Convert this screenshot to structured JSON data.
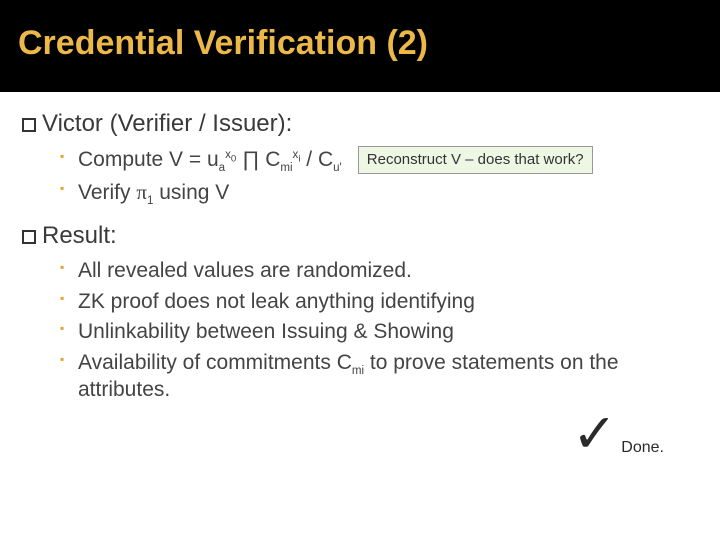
{
  "title": "Credential Verification (2)",
  "section1": {
    "head": "Victor (Verifier / Issuer):",
    "compute_prefix": "Compute V  = u",
    "compute_sub_a": "a",
    "compute_sup_x0": "x",
    "compute_sup_x0_sub": "0",
    "compute_prod": " ∏ C",
    "compute_cm_sub": "mi",
    "compute_sup_xi": "x",
    "compute_sup_xi_sub": "i",
    "compute_div": " / C",
    "compute_cu_sub": "u'",
    "note": "Reconstruct V – does that work?",
    "verify_prefix": "Verify ",
    "verify_pi": "π",
    "verify_sub1": "1",
    "verify_suffix": " using V"
  },
  "section2": {
    "head": "Result:",
    "items": [
      "All revealed values are randomized.",
      "ZK proof does not leak anything identifying",
      "Unlinkability between Issuing & Showing"
    ],
    "item4_prefix": "Availability of commitments C",
    "item4_sub": "mi",
    "item4_suffix": " to prove statements on the attributes."
  },
  "checkmark": "✓",
  "done": "Done."
}
